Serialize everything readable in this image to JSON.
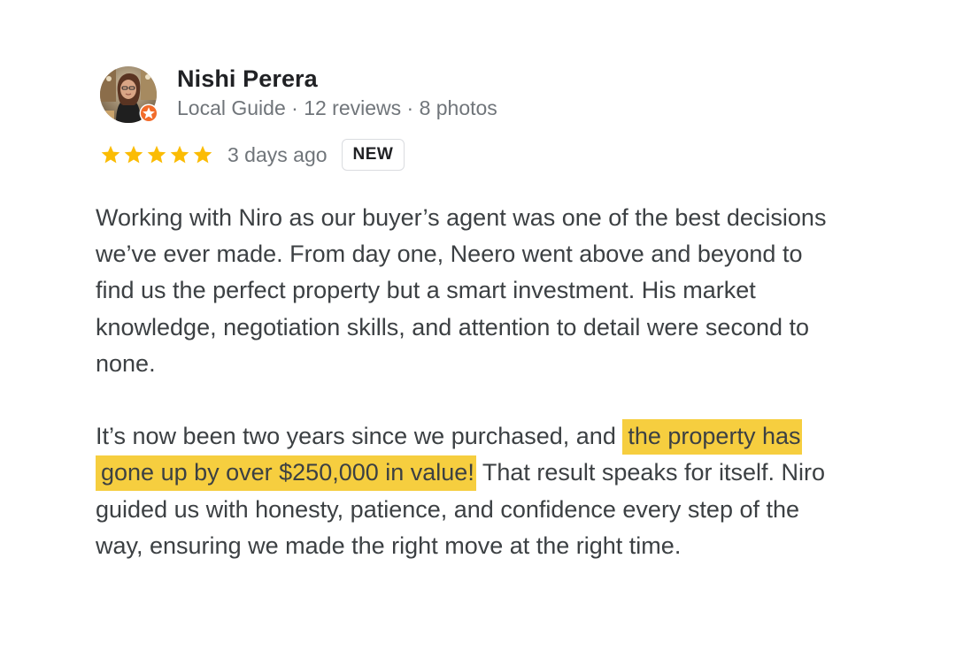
{
  "review": {
    "author": {
      "name": "Nishi Perera",
      "meta": "Local Guide · 12 reviews · 8 photos",
      "avatar_icon": "profile-photo",
      "badge_icon": "local-guide-star-badge"
    },
    "rating": {
      "stars": 5,
      "max_stars": 5,
      "star_color": "#fbbc04",
      "date": "3 days ago",
      "badge": "NEW"
    },
    "body": {
      "paragraph1": "Working with Niro as our buyer’s agent was one of the best decisions we’ve ever made. From day one, Neero went above and beyond to find us the perfect property but a smart investment. His market knowledge, negotiation skills, and attention to detail were second to none.",
      "paragraph2_before": "It’s now been two years since we purchased, and ",
      "paragraph2_highlight": "the property has gone up by over $250,000 in value!",
      "paragraph2_after": " That result speaks for itself. Niro guided us with honesty, patience, and confidence every step of the way, ensuring we made the right move at the right time."
    },
    "colors": {
      "highlight": "#f6ce3f",
      "guide_badge": "#f26b2a",
      "name_text": "#202124",
      "body_text": "#3c4043",
      "meta_text": "#70757a"
    }
  }
}
